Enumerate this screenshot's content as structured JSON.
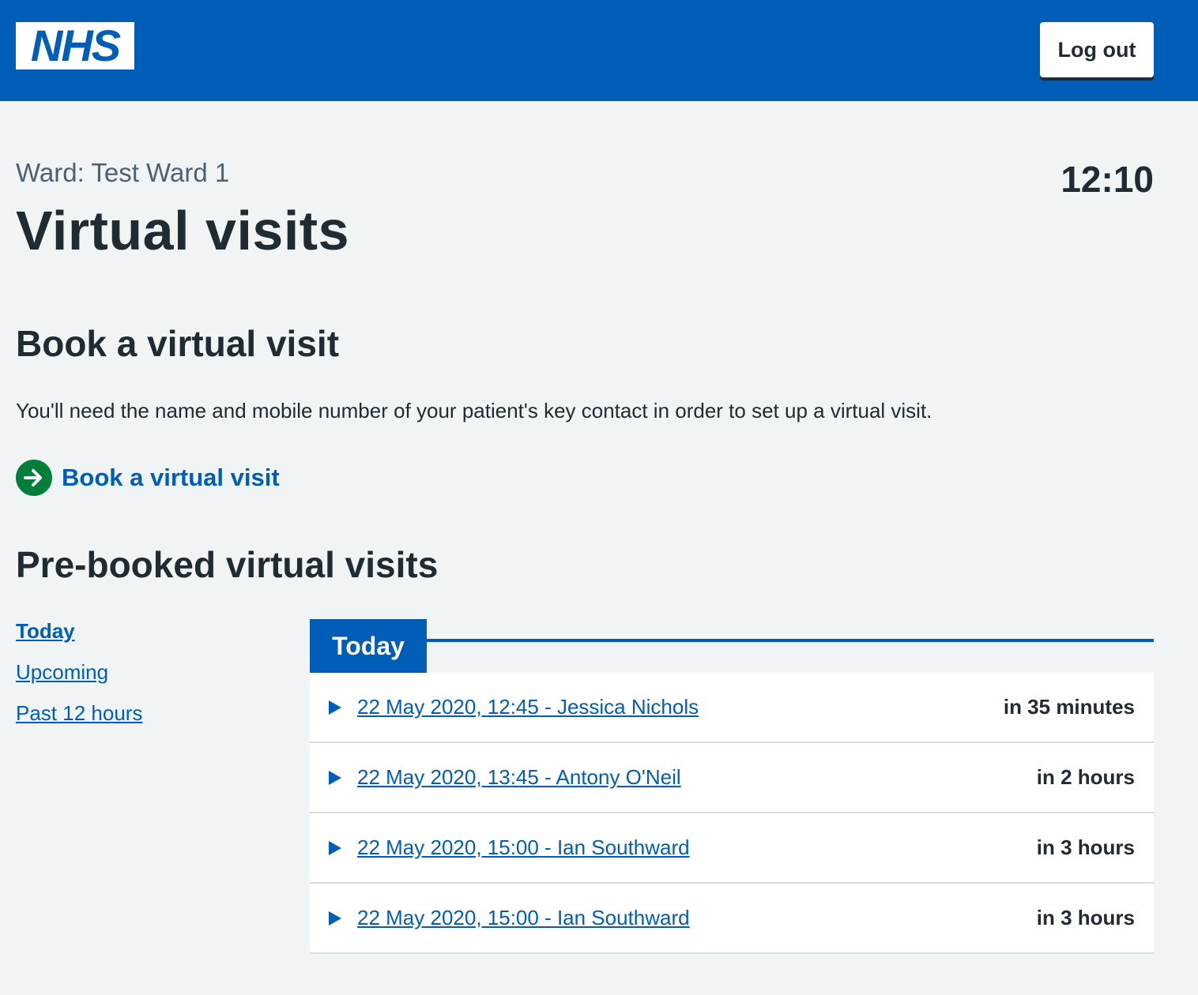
{
  "header": {
    "logo_text": "NHS",
    "logout_label": "Log out"
  },
  "page": {
    "ward": "Ward: Test Ward 1",
    "title": "Virtual visits",
    "time": "12:10"
  },
  "book": {
    "heading": "Book a virtual visit",
    "description": "You'll need the name and mobile number of your patient's key contact in order to set up a virtual visit.",
    "action_label": "Book a virtual visit",
    "action_icon": "arrow-right-circle-icon"
  },
  "prebooked": {
    "heading": "Pre-booked virtual visits",
    "nav": [
      {
        "label": "Today",
        "current": true
      },
      {
        "label": "Upcoming",
        "current": false
      },
      {
        "label": "Past 12 hours",
        "current": false
      }
    ],
    "tab_title": "Today",
    "visits": [
      {
        "label": "22 May 2020, 12:45 - Jessica Nichols",
        "when": "in 35 minutes"
      },
      {
        "label": "22 May 2020, 13:45 - Antony O'Neil",
        "when": "in 2 hours"
      },
      {
        "label": "22 May 2020, 15:00 - Ian Southward",
        "when": "in 3 hours"
      },
      {
        "label": "22 May 2020, 15:00 - Ian Southward",
        "when": "in 3 hours"
      }
    ]
  },
  "colors": {
    "nhs_blue": "#005eb8",
    "action_green": "#007f3b",
    "background": "#f0f4f5",
    "text": "#212b32",
    "secondary_text": "#4c6272"
  }
}
